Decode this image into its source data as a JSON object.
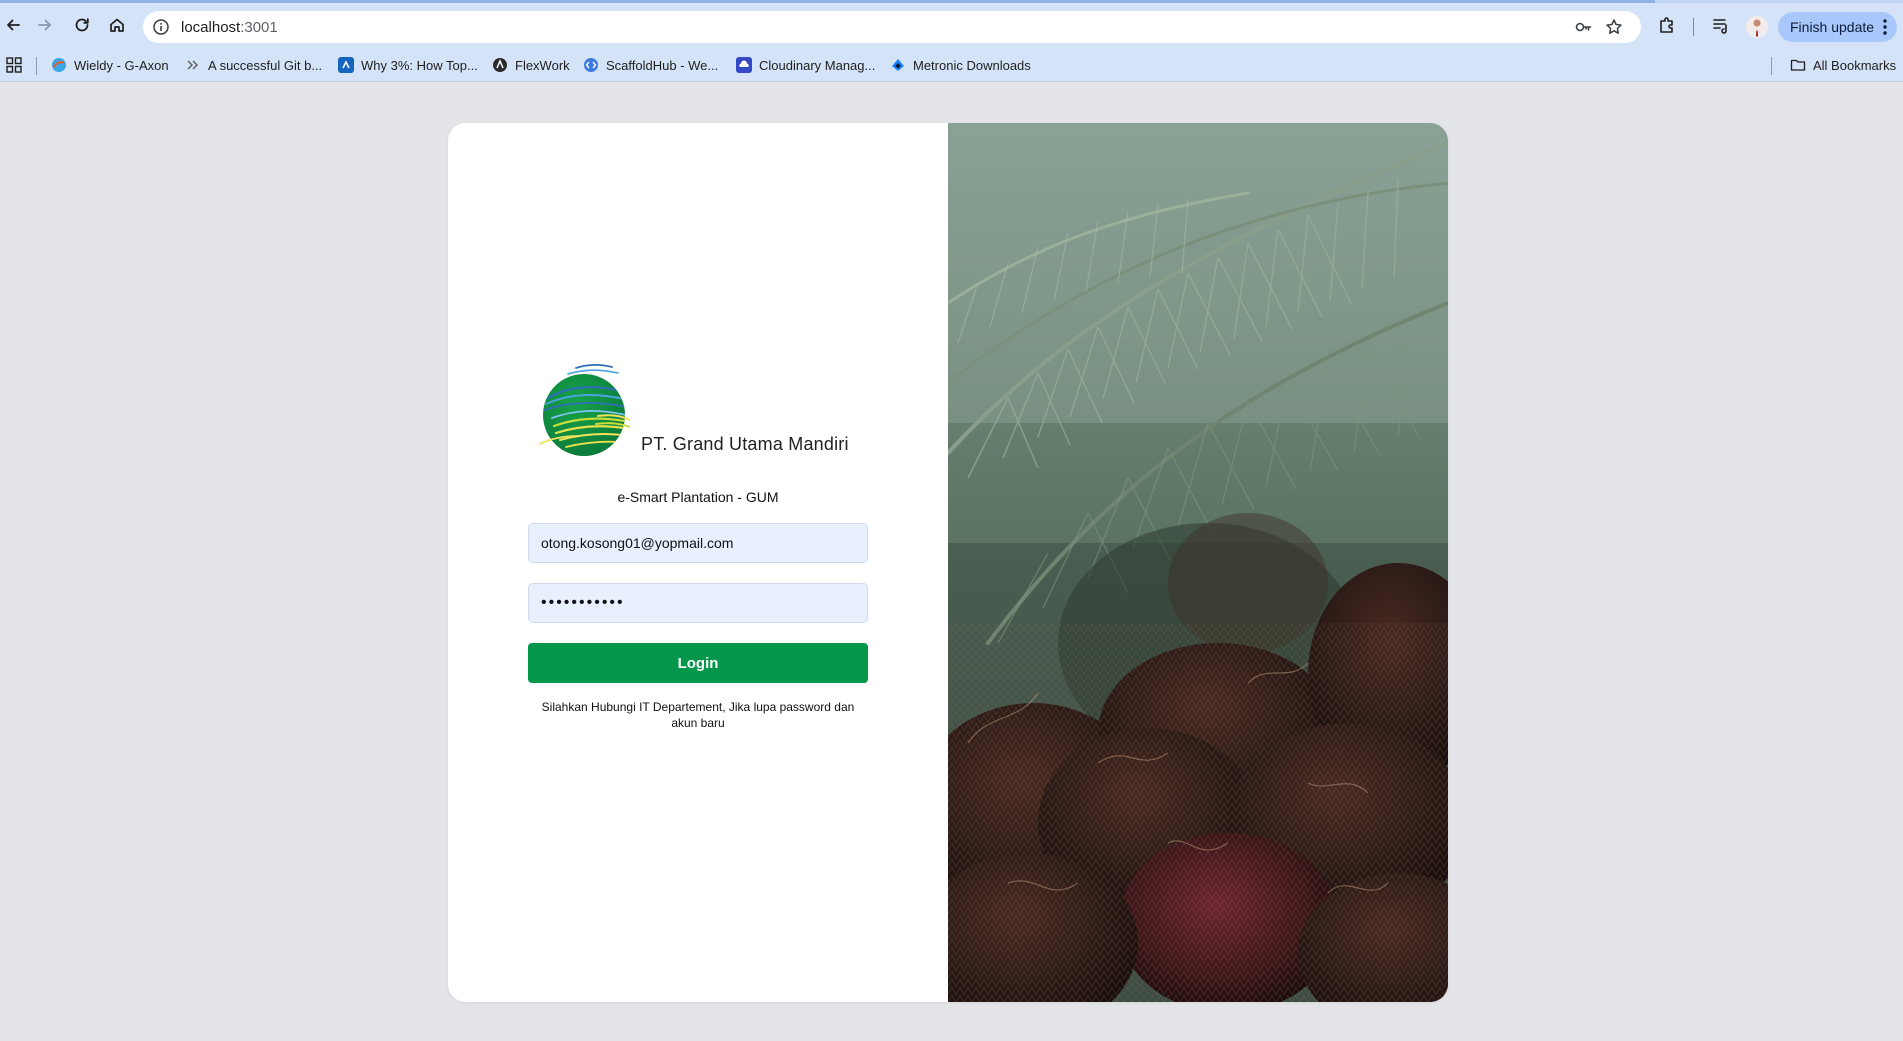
{
  "browser": {
    "url_host": "localhost",
    "url_port": ":3001",
    "finish_update_label": "Finish update",
    "all_bookmarks_label": "All Bookmarks",
    "bookmarks": [
      {
        "label": "Wieldy - G-Axon",
        "icon": "wieldy-favicon"
      },
      {
        "label": "A successful Git b...",
        "icon": "chevron-double-right-icon"
      },
      {
        "label": "Why 3%: How Top...",
        "icon": "blue-square-favicon"
      },
      {
        "label": "FlexWork",
        "icon": "flexwork-favicon"
      },
      {
        "label": "ScaffoldHub - We...",
        "icon": "scaffoldhub-favicon"
      },
      {
        "label": "Cloudinary Manag...",
        "icon": "cloudinary-favicon"
      },
      {
        "label": "Metronic Downloads",
        "icon": "metronic-favicon"
      }
    ]
  },
  "login": {
    "company_name": "PT. Grand Utama Mandiri",
    "app_title": "e-Smart Plantation - GUM",
    "email_value": "otong.kosong01@yopmail.com",
    "password_value": "•••••••••••",
    "login_label": "Login",
    "help_text": "Silahkan Hubungi IT Departement, Jika lupa password dan akun baru"
  },
  "colors": {
    "login_button": "#04964b",
    "input_bg": "#e8f0fe",
    "page_bg": "#e3e4e8",
    "chrome_bg": "#d5e3f8"
  }
}
